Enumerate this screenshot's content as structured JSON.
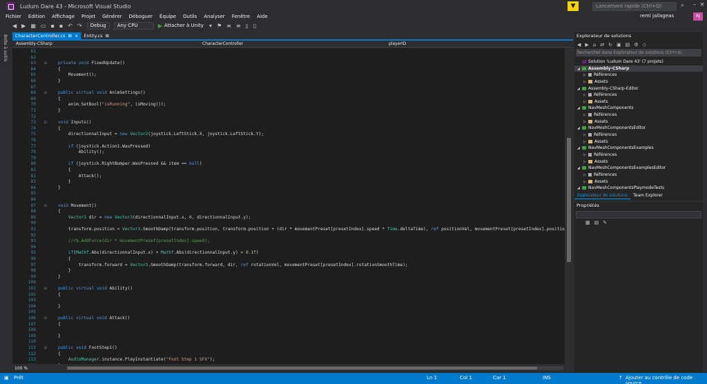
{
  "window": {
    "title": "Ludum Dare 43 - Microsoft Visual Studio",
    "quick_launch_placeholder": "Lancement rapide (Ctrl+Q)",
    "user_name": "remi jallageas",
    "user_initials": "RJ"
  },
  "menu": [
    "Fichier",
    "Edition",
    "Affichage",
    "Projet",
    "Générer",
    "Déboguer",
    "Équipe",
    "Outils",
    "Analyser",
    "Fenêtre",
    "Aide"
  ],
  "toolbar": {
    "config": "Debug",
    "platform": "Any CPU",
    "attach_label": "Attacher à Unity"
  },
  "left_strip": {
    "toolbox_label": "Boîte à outils"
  },
  "editor": {
    "tabs": [
      {
        "label": "CharacterController.cs",
        "active": true
      },
      {
        "label": "Entity.cs",
        "active": false
      }
    ],
    "nav": {
      "project": "Assembly-CSharp",
      "class": "CharacterController",
      "member": "playerID"
    },
    "zoom": "100 %",
    "lines": [
      {
        "n": "61",
        "t": ""
      },
      {
        "n": "62",
        "t": ""
      },
      {
        "n": "63",
        "t": "private void FixedUpdate()"
      },
      {
        "n": "64",
        "t": "{"
      },
      {
        "n": "65",
        "t": "    Movement();"
      },
      {
        "n": "66",
        "t": "}"
      },
      {
        "n": "67",
        "t": ""
      },
      {
        "n": "68",
        "t": "public virtual void AnimSettings()"
      },
      {
        "n": "69",
        "t": "{"
      },
      {
        "n": "70",
        "t": "    anim.SetBool(\"isRunning\", isMoving());"
      },
      {
        "n": "71",
        "t": "}"
      },
      {
        "n": "72",
        "t": ""
      },
      {
        "n": "73",
        "t": "void Inputs()"
      },
      {
        "n": "74",
        "t": "{"
      },
      {
        "n": "75",
        "t": "    directionnalInput = new Vector2(joystick.LeftStick.X, joystick.LeftStick.Y);"
      },
      {
        "n": "76",
        "t": ""
      },
      {
        "n": "77",
        "t": "    if (joystick.Action1.WasPressed)"
      },
      {
        "n": "78",
        "t": "        Ability();"
      },
      {
        "n": "79",
        "t": ""
      },
      {
        "n": "80",
        "t": "    if (joystick.RightBumper.WasPressed && item == null)"
      },
      {
        "n": "81",
        "t": "    {"
      },
      {
        "n": "82",
        "t": "        Attack();"
      },
      {
        "n": "83",
        "t": "    }"
      },
      {
        "n": "84",
        "t": "}"
      },
      {
        "n": "85",
        "t": ""
      },
      {
        "n": "86",
        "t": ""
      },
      {
        "n": "87",
        "t": "void Movement()"
      },
      {
        "n": "88",
        "t": "{"
      },
      {
        "n": "89",
        "t": "    Vector3 dir = new Vector3(directionnalInput.x, 0, directionnalInput.y);"
      },
      {
        "n": "90",
        "t": ""
      },
      {
        "n": "91",
        "t": "    transform.position = Vector3.SmoothDamp(transform.position, transform.position + (dir * movementPreset[presetIndex].speed * Time.deltaTime), ref positionVel, movementPreset[presetIndex].positionS"
      },
      {
        "n": "92",
        "t": ""
      },
      {
        "n": "93",
        "t": "    //rb.AddForce(dir * movementPreset[presetIndex].speed);"
      },
      {
        "n": "94",
        "t": ""
      },
      {
        "n": "95",
        "t": "    if(Mathf.Abs(directionnalInput.x) + Mathf.Abs(directionnalInput.y) > 0.1f)"
      },
      {
        "n": "96",
        "t": "    {"
      },
      {
        "n": "97",
        "t": "        transform.forward = Vector3.SmoothDamp(transform.forward, dir, ref rotationVel, movementPreset[presetIndex].rotationSmoothTime);"
      },
      {
        "n": "98",
        "t": "    }"
      },
      {
        "n": "99",
        "t": "}"
      },
      {
        "n": "100",
        "t": ""
      },
      {
        "n": "101",
        "t": "public virtual void Ability()"
      },
      {
        "n": "102",
        "t": "{"
      },
      {
        "n": "103",
        "t": ""
      },
      {
        "n": "104",
        "t": "}"
      },
      {
        "n": "105",
        "t": ""
      },
      {
        "n": "106",
        "t": "public virtual void Attack()"
      },
      {
        "n": "107",
        "t": "{"
      },
      {
        "n": "108",
        "t": ""
      },
      {
        "n": "109",
        "t": "}"
      },
      {
        "n": "110",
        "t": ""
      },
      {
        "n": "111",
        "t": "public void FootStep1()"
      },
      {
        "n": "112",
        "t": "{"
      },
      {
        "n": "113",
        "t": "    AudioManager.instance.PlayInstantiate(\"Foot Step 1 SFX\");"
      },
      {
        "n": "114",
        "t": "}"
      }
    ]
  },
  "solution_explorer": {
    "title": "Explorateur de solutions",
    "search_placeholder": "Rechercher dans Explorateur de solutions (Ctrl+$)",
    "tree": [
      {
        "level": 0,
        "icon": "sol",
        "label": "Solution 'Ludum Dare 43' (7 projets)"
      },
      {
        "level": 0,
        "icon": "proj",
        "label": "Assembly-CSharp",
        "selected": true
      },
      {
        "level": 1,
        "icon": "ref",
        "label": "Références"
      },
      {
        "level": 1,
        "icon": "folder",
        "label": "Assets"
      },
      {
        "level": 0,
        "icon": "proj",
        "label": "Assembly-CSharp-Editor"
      },
      {
        "level": 1,
        "icon": "ref",
        "label": "Références"
      },
      {
        "level": 1,
        "icon": "folder",
        "label": "Assets"
      },
      {
        "level": 0,
        "icon": "proj",
        "label": "NavMeshComponents"
      },
      {
        "level": 1,
        "icon": "ref",
        "label": "Références"
      },
      {
        "level": 1,
        "icon": "folder",
        "label": "Assets"
      },
      {
        "level": 0,
        "icon": "proj",
        "label": "NavMeshComponentsEditor"
      },
      {
        "level": 1,
        "icon": "ref",
        "label": "Références"
      },
      {
        "level": 1,
        "icon": "folder",
        "label": "Assets"
      },
      {
        "level": 0,
        "icon": "proj",
        "label": "NavMeshComponentsExamples"
      },
      {
        "level": 1,
        "icon": "ref",
        "label": "Références"
      },
      {
        "level": 1,
        "icon": "folder",
        "label": "Assets"
      },
      {
        "level": 0,
        "icon": "proj",
        "label": "NavMeshComponentsExamplesEditor"
      },
      {
        "level": 1,
        "icon": "ref",
        "label": "Références"
      },
      {
        "level": 1,
        "icon": "folder",
        "label": "Assets"
      },
      {
        "level": 0,
        "icon": "proj",
        "label": "NavMeshComponentsPlaymodeTests"
      }
    ],
    "bottom_tabs": [
      "Explorateur de solutions",
      "Team Explorer"
    ]
  },
  "properties": {
    "title": "Propriétés"
  },
  "status_bar": {
    "state": "Prêt",
    "line": "Ln 1",
    "col": "Col 1",
    "char": "Car 1",
    "mode": "INS",
    "source_control": "Ajouter au contrôle de code source"
  }
}
